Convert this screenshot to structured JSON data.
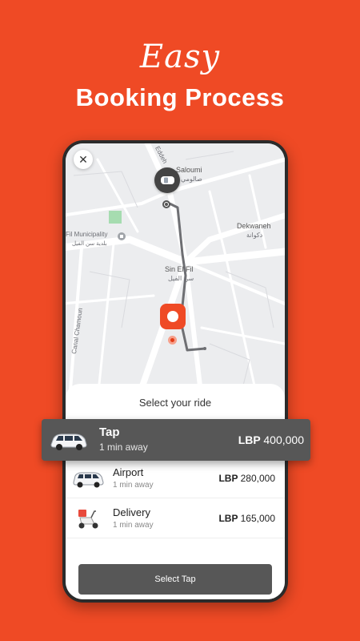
{
  "headline": {
    "script": "Easy",
    "main": "Booking Process"
  },
  "map": {
    "labels": {
      "street_top": "Eddeh",
      "saloumi": "Saloumi",
      "saloumi_ar": "صالومي",
      "dekwaneh": "Dekwaneh",
      "dekwaneh_ar": "دكوانة",
      "municipality": "Fil Municipality",
      "municipality_ar": "بلدية سن الفيل",
      "sin_el_fil": "Sin El Fil",
      "sin_el_fil_ar": "سن الفيل",
      "canal": "Canal Chamoun"
    }
  },
  "sheet": {
    "title": "Select your ride"
  },
  "rides": [
    {
      "name": "Tap",
      "eta": "1 min away",
      "currency": "LBP",
      "amount": "400,000"
    },
    {
      "name": "Airport",
      "eta": "1 min away",
      "currency": "LBP",
      "amount": "280,000"
    },
    {
      "name": "Delivery",
      "eta": "1 min away",
      "currency": "LBP",
      "amount": "165,000"
    }
  ],
  "select_button": "Select Tap",
  "colors": {
    "brand": "#ef4a25",
    "panel": "#575757"
  },
  "icons": {
    "close": "close-icon",
    "pickup": "pickup-pin-icon",
    "dropoff": "dropoff-pin-icon",
    "car": "car-icon",
    "scooter": "scooter-icon"
  }
}
